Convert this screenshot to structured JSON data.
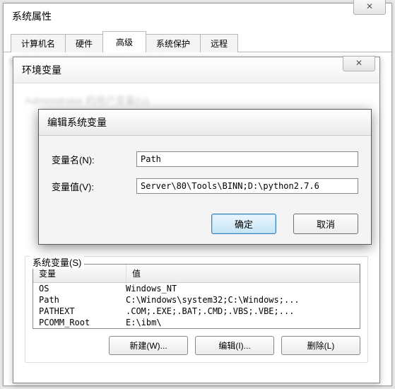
{
  "sysprop": {
    "title": "系统属性",
    "close": "✕",
    "tabs": {
      "computer": "计算机名",
      "hardware": "硬件",
      "advanced": "高级",
      "protect": "系统保护",
      "remote": "远程"
    }
  },
  "envvar": {
    "title": "环境变量",
    "close": "✕",
    "user_vars_label": "Administrator 的用户变量(U)",
    "system_vars_label": "系统变量(S)",
    "headers": {
      "name": "变量",
      "value": "值"
    },
    "rows": [
      {
        "name": "OS",
        "value": "Windows_NT"
      },
      {
        "name": "Path",
        "value": "C:\\Windows\\system32;C:\\Windows;..."
      },
      {
        "name": "PATHEXT",
        "value": ".COM;.EXE;.BAT;.CMD;.VBS;.VBE;..."
      },
      {
        "name": "PCOMM_Root",
        "value": "E:\\ibm\\"
      }
    ],
    "buttons": {
      "new": "新建(W)...",
      "edit": "编辑(I)...",
      "del": "删除(L)"
    }
  },
  "edit": {
    "title": "编辑系统变量",
    "name_label": "变量名(N):",
    "value_label": "变量值(V):",
    "name_value": "Path",
    "value_value": "Server\\80\\Tools\\BINN;D:\\python2.7.6",
    "ok": "确定",
    "cancel": "取消"
  }
}
